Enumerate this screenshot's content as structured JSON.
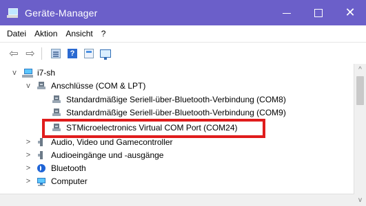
{
  "window": {
    "title": "Geräte-Manager",
    "controls": {
      "minimize_icon": "minimize-icon",
      "maximize_icon": "maximize-icon",
      "close_icon": "close-icon",
      "close_glyph": "✕"
    },
    "colors": {
      "title_bar": "#6b5fc9",
      "highlight": "#e01c1c"
    }
  },
  "menu": {
    "items": [
      "Datei",
      "Aktion",
      "Ansicht",
      "?"
    ]
  },
  "toolbar": {
    "buttons": [
      {
        "icon": "back-arrow-icon",
        "glyph": "⇦"
      },
      {
        "icon": "forward-arrow-icon",
        "glyph": "⇨"
      },
      {
        "icon": "show-hide-console-tree-icon"
      },
      {
        "icon": "help-icon",
        "glyph": "?"
      },
      {
        "icon": "properties-icon"
      },
      {
        "icon": "scan-hardware-icon"
      }
    ]
  },
  "tree": {
    "root": {
      "label": "i7-sh",
      "expander": "v",
      "icon": "computer-icon"
    },
    "categories": [
      {
        "label": "Anschlüsse (COM & LPT)",
        "expander": "v",
        "icon": "ports-icon",
        "children": [
          {
            "label": "Standardmäßige Seriell-über-Bluetooth-Verbindung (COM8)",
            "icon": "port-device-icon"
          },
          {
            "label": "Standardmäßige Seriell-über-Bluetooth-Verbindung (COM9)",
            "icon": "port-device-icon"
          },
          {
            "label": "STMicroelectronics Virtual COM Port (COM24)",
            "icon": "port-device-icon",
            "highlighted": true
          }
        ]
      },
      {
        "label": "Audio, Video und Gamecontroller",
        "expander": ">",
        "icon": "audio-icon"
      },
      {
        "label": "Audioeingänge und -ausgänge",
        "expander": ">",
        "icon": "audio-io-icon"
      },
      {
        "label": "Bluetooth",
        "expander": ">",
        "icon": "bluetooth-icon"
      },
      {
        "label": "Computer",
        "expander": ">",
        "icon": "computer-category-icon"
      }
    ]
  },
  "scrollbar": {
    "up_glyph": "^",
    "down_glyph": "v"
  }
}
